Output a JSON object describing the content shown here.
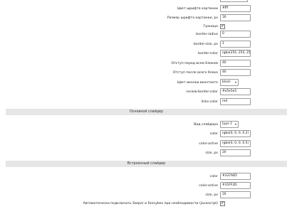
{
  "settings_top": [
    {
      "label": "Цвет шрифта картинки",
      "value": "#fff"
    },
    {
      "label": "Размер шрифта картинки, px",
      "value": "16"
    }
  ],
  "border_toggle": {
    "label": "Граница",
    "checked": true,
    "mark": "✔"
  },
  "settings_mid": [
    {
      "label": "border-radius",
      "value": "0"
    },
    {
      "label": "border-size, px",
      "value": "1"
    },
    {
      "label": "border-color",
      "value": "rgba(255, 255, 255"
    },
    {
      "label": "Отступ перед всем блоком",
      "value": "40"
    },
    {
      "label": "Отступ после всего блока",
      "value": "40"
    }
  ],
  "vk_icon": {
    "label": "Цвет иконки вконтакте",
    "value": "black",
    "arrow": "▾"
  },
  "settings_tail": [
    {
      "label": "review-border-color",
      "value": "#e5e5e5"
    },
    {
      "label": "links-color",
      "value": "red"
    }
  ],
  "main_slider": {
    "title": "Основной слайдер",
    "type_label": "Вид слайдера",
    "type_value": "type 1",
    "type_arrow": "▾",
    "fields": [
      {
        "label": "color",
        "value": "rgba(0, 0, 0, 0.2)"
      },
      {
        "label": "color-active",
        "value": "rgba(0, 0, 0, 0.5)"
      },
      {
        "label": "size, px",
        "value": "20"
      }
    ]
  },
  "builtin_slider": {
    "title": "Встроенный слайдер",
    "fields": [
      {
        "label": "color",
        "value": "#337AB5"
      },
      {
        "label": "color-active",
        "value": "#31FF2D"
      },
      {
        "label": "size, px",
        "value": "20"
      }
    ]
  },
  "autoload": {
    "label": "Автоматически подключать Swiper и Fancybox при необходимости (javascript)",
    "checked": true,
    "mark": "✔"
  }
}
